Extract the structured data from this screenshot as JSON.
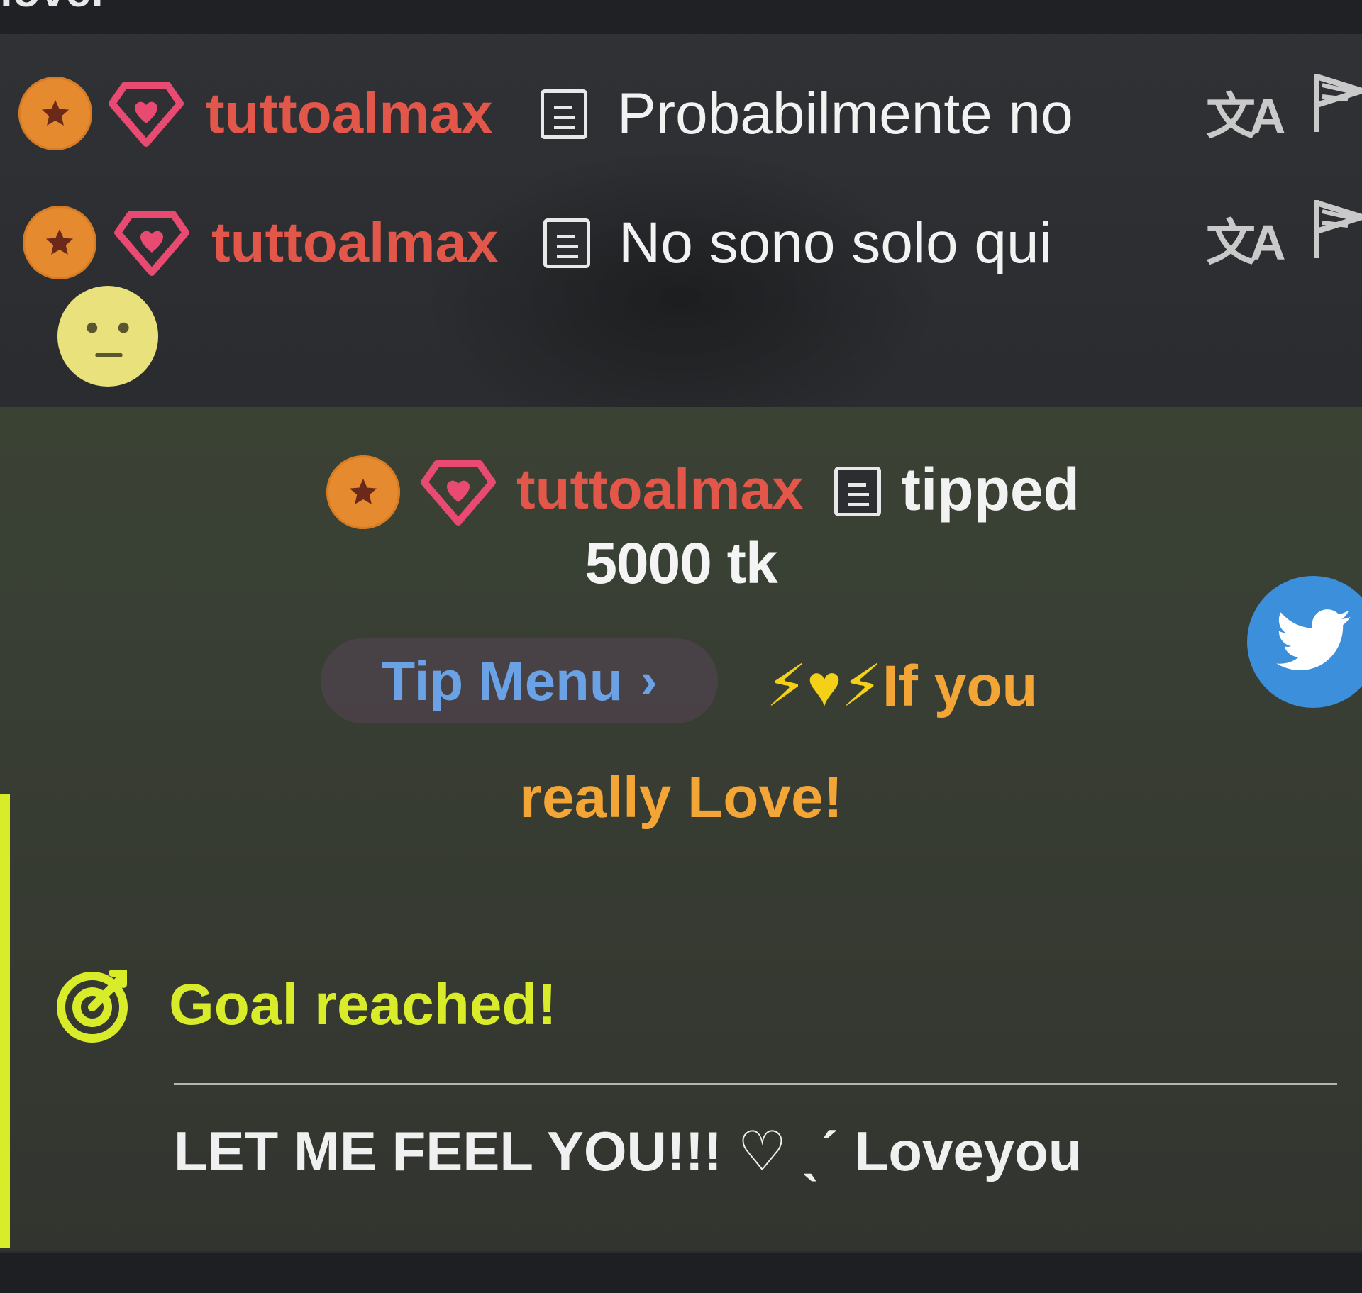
{
  "top_cut_text": "lover",
  "chat": {
    "messages": [
      {
        "username": "tuttoalmax",
        "text": "Probabilmente no"
      },
      {
        "username": "tuttoalmax",
        "text": "No sono solo qui"
      }
    ],
    "translate_glyph": "文A",
    "icons": {
      "fanclub_badge": "star-badge-icon",
      "gem_badge": "heart-gem-icon",
      "notes": "note-icon",
      "translate": "translate-icon",
      "report": "report-flag-icon",
      "emoji": "neutral-smiley-emoji"
    }
  },
  "tip": {
    "username": "tuttoalmax",
    "action": "tipped",
    "amount": "5000 tk",
    "tip_menu_label": "Tip Menu",
    "tip_menu_chevron": "›",
    "menu_item_line1": "If you",
    "menu_item_line2": "really Love!",
    "menu_item_emoji": "⚡♥⚡"
  },
  "goal": {
    "status": "Goal reached!",
    "description": "LET ME FEEL YOU!!! ♡ ˎˊ Loveyou"
  },
  "social": {
    "twitter_icon": "twitter-bird-icon"
  },
  "colors": {
    "username": "#e3574a",
    "badge_orange": "#e58a2f",
    "gem_pink": "#e94a72",
    "tip_menu_blue": "#6ba2e6",
    "menu_orange": "#f3a536",
    "goal_yellow": "#d8ec2a",
    "twitter_blue": "#3b8fdb"
  }
}
